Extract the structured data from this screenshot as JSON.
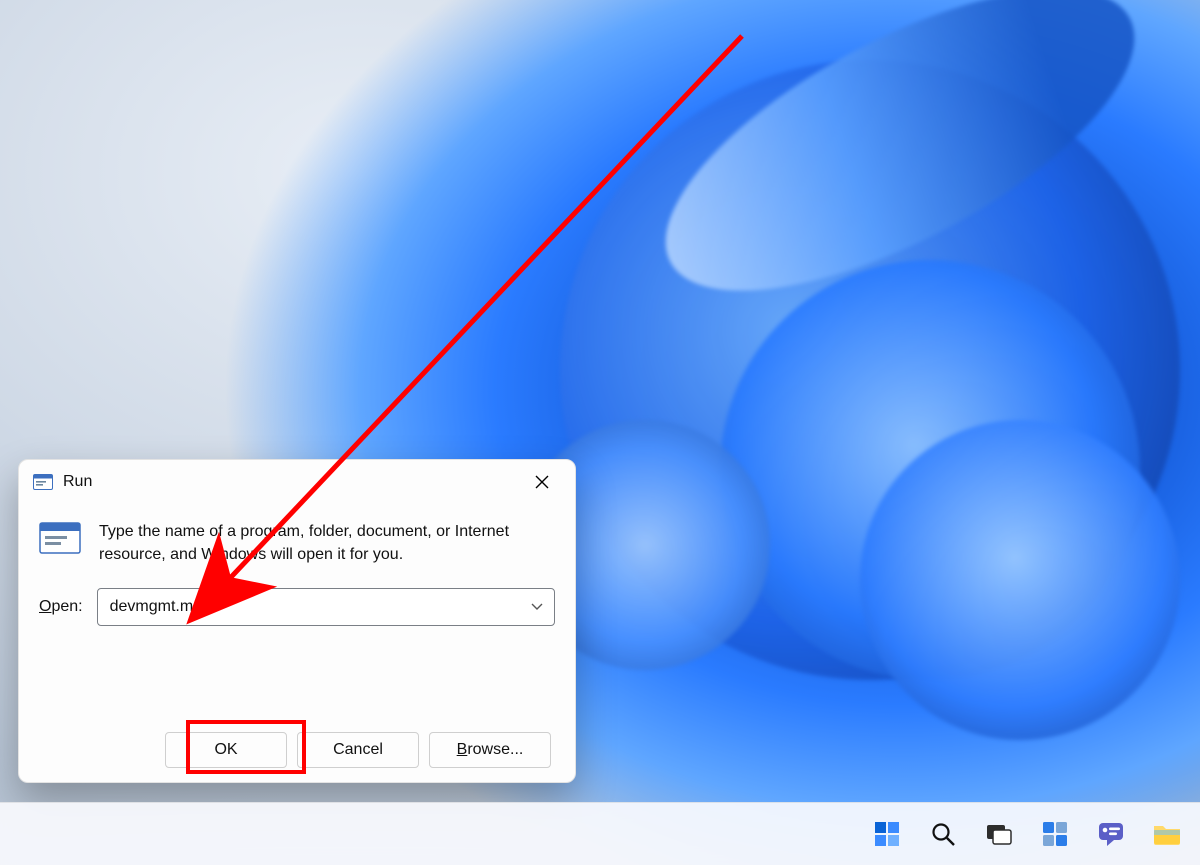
{
  "dialog": {
    "title": "Run",
    "description": "Type the name of a program, folder, document, or Internet resource, and Windows will open it for you.",
    "open_label_underline": "O",
    "open_label_rest": "pen:",
    "input_value": "devmgmt.msc",
    "buttons": {
      "ok": "OK",
      "cancel": "Cancel",
      "browse_underline": "B",
      "browse_rest": "rowse..."
    }
  },
  "taskbar": {
    "items": [
      "start-icon",
      "search-icon",
      "task-view-icon",
      "widgets-icon",
      "chat-icon",
      "file-explorer-icon"
    ]
  },
  "annotation": {
    "arrow_color": "#ff0000",
    "highlight_target": "ok-button"
  }
}
